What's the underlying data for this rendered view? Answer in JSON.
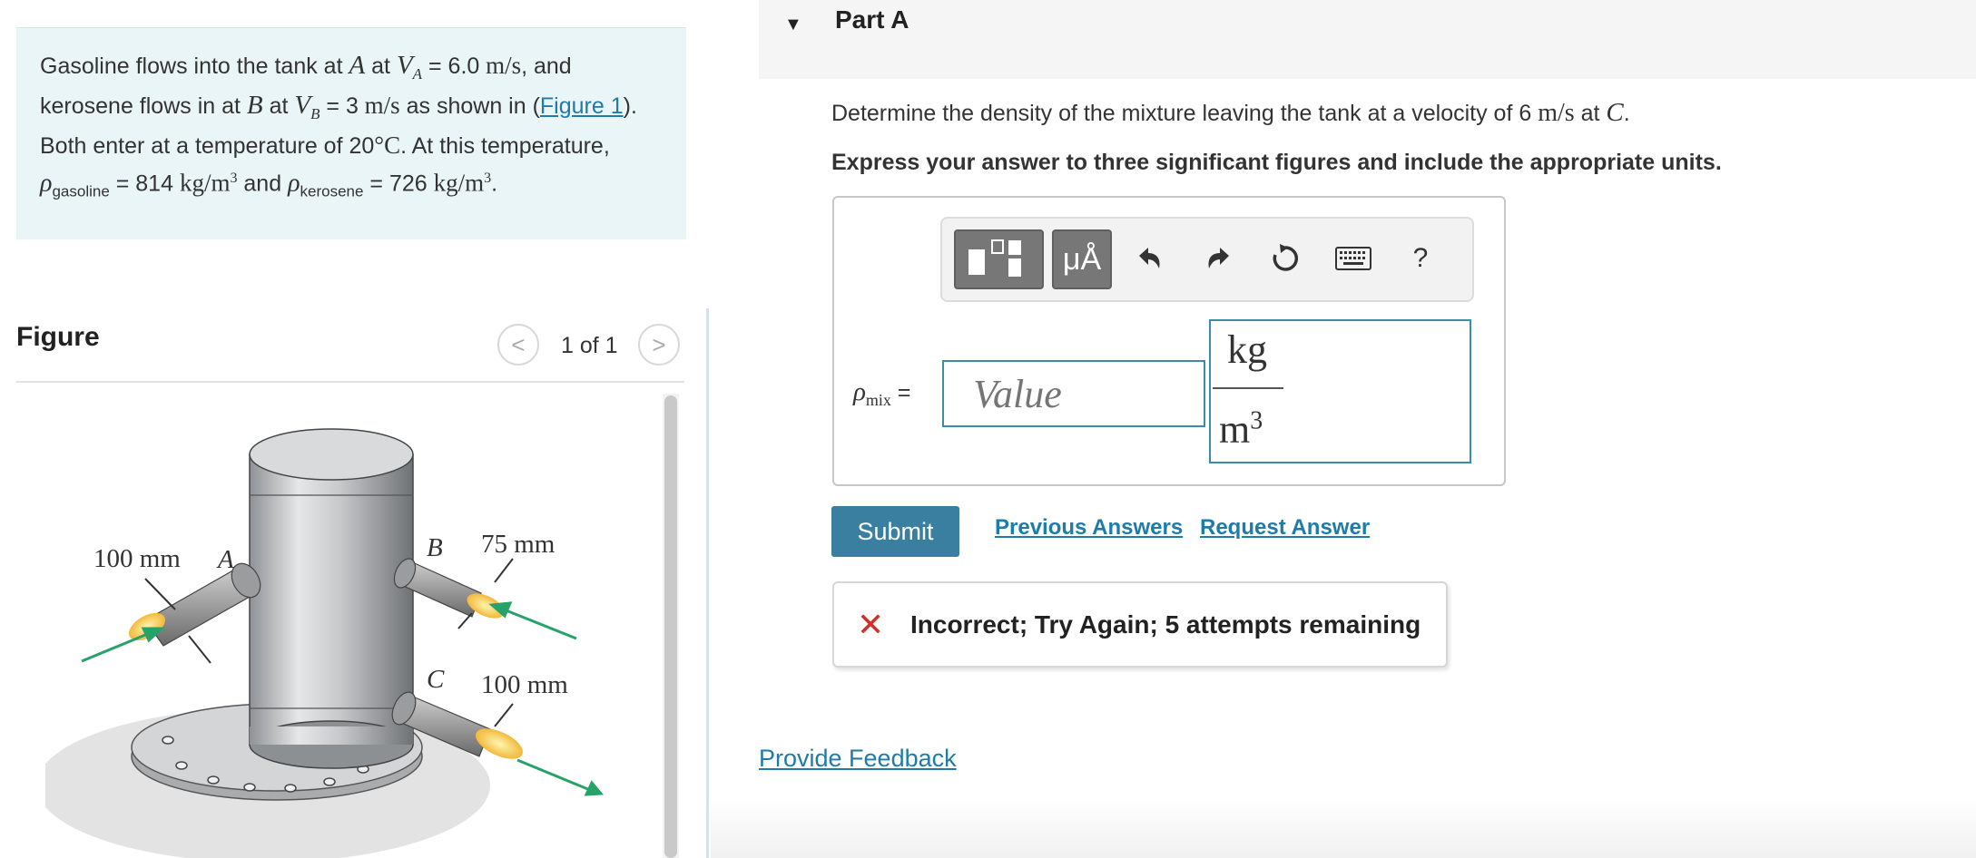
{
  "problem": {
    "s1": "Gasoline flows into the tank at ",
    "A": "A",
    "s2": " at ",
    "VA_sym": "V",
    "VA_sub": "A",
    "eq": " = ",
    "VA_val": "6.0",
    "ms": " m/s",
    "s3": ", and kerosene flows in at ",
    "B": "B",
    "s4": " at ",
    "VB_sym": "V",
    "VB_sub": "B",
    "VB_val": "3",
    "s5": " as shown in (",
    "fig_link": "Figure 1",
    "s6": "). Both enter at a temperature of 20",
    "degC": "°C",
    "s7": ". At this temperature, ",
    "rho": "ρ",
    "gas_sub": "gasoline",
    "gas_val": " = 814 ",
    "kgm": "kg/m",
    "cube": "3",
    "and": " and ",
    "ker_sub": "kerosene",
    "ker_val": " = 726 ",
    "period": "."
  },
  "figure": {
    "heading": "Figure",
    "pager": "1 of 1",
    "prev": "<",
    "next": ">",
    "labels": {
      "d_a": "100 mm",
      "a": "A",
      "b": "B",
      "d_b": "75 mm",
      "c": "C",
      "d_c": "100 mm"
    }
  },
  "part": {
    "caret": "▼",
    "title": "Part A",
    "q_text": "Determine the density of the mixture leaving the tank at a velocity of 6 ",
    "q_unit": "m/s",
    "q_at": " at ",
    "q_C": "C",
    "q_end": ".",
    "instruction": "Express your answer to three significant figures and include the appropriate units."
  },
  "toolbar": {
    "units_btn": "μÅ",
    "help": "?"
  },
  "answer": {
    "rho": "ρ",
    "sub": "mix",
    "eq": " =",
    "placeholder": "Value",
    "unit_num": "kg",
    "unit_den": "m",
    "unit_exp": "3"
  },
  "actions": {
    "submit": "Submit",
    "previous": "Previous Answers",
    "request": "Request Answer"
  },
  "feedback": {
    "icon": "✕",
    "text": "Incorrect; Try Again; 5 attempts remaining"
  },
  "provide_feedback": "Provide Feedback",
  "colors": {
    "accent": "#3a7ea0",
    "link": "#1f7ba8",
    "error": "#d0302a",
    "problem_bg": "#e9f5f7"
  }
}
